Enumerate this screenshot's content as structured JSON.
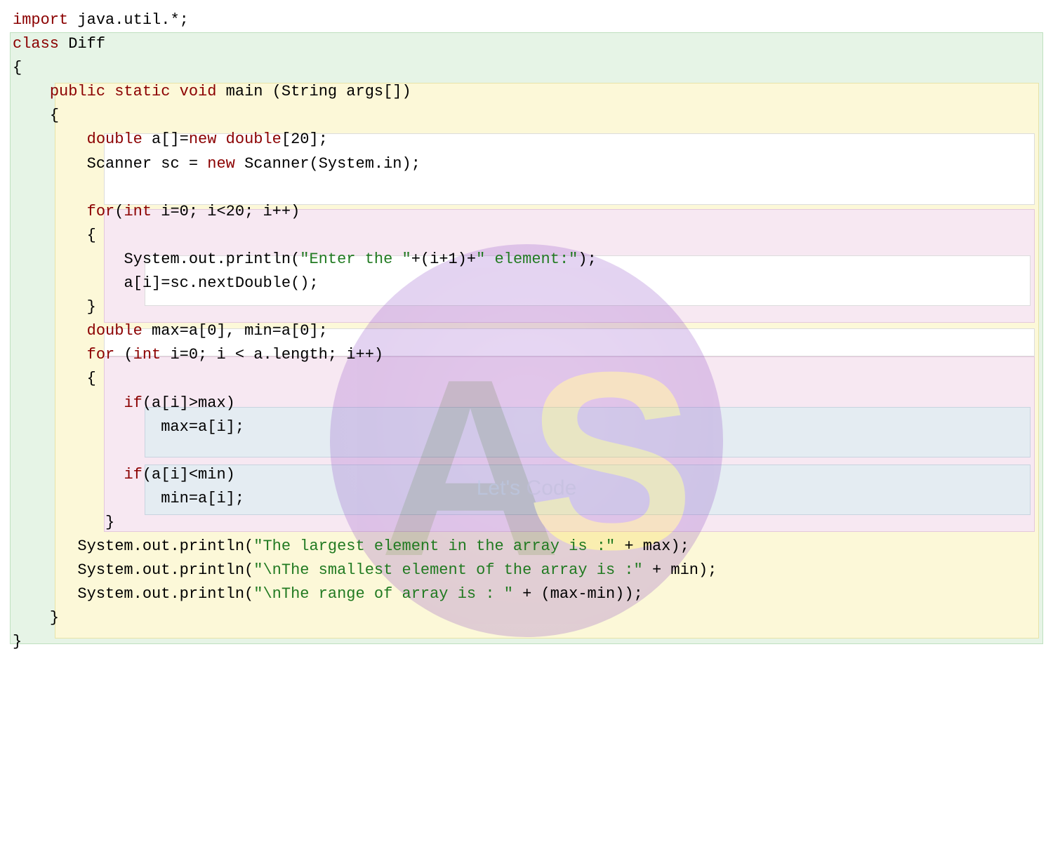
{
  "watermark": {
    "letter1": "A",
    "letter2": "S",
    "tag_part1": "Let's ",
    "tag_part2": "Code"
  },
  "code": {
    "l1_import": "import",
    "l1_pkg": " java.util.*;",
    "l2_class": "class",
    "l2_name": " Diff",
    "l3_brace": "{",
    "l4_pub": "public",
    "l4_static": "static",
    "l4_void": "void",
    "l4_main": " main (String args[])",
    "l5_brace": "{",
    "l6_double": "double",
    "l6_a": " a[]=",
    "l6_new": "new",
    "l6_dbl2": " double",
    "l6_rest": "[20];",
    "l7": "Scanner sc = ",
    "l7_new": "new",
    "l7_rest": " Scanner(System.in);",
    "l8_for": "for",
    "l8_open": "(",
    "l8_int": "int",
    "l8_rest": " i=0; i<20; i++)",
    "l9_brace": "{",
    "l10_a": "System.out.println(",
    "l10_s1": "\"Enter the \"",
    "l10_b": "+(i+1)+",
    "l10_s2": "\" element:\"",
    "l10_c": ");",
    "l11": "a[i]=sc.nextDouble();",
    "l12_brace": "}",
    "l13_double": "double",
    "l13_rest": " max=a[0], min=a[0];",
    "l14_for": "for",
    "l14_open": " (",
    "l14_int": "int",
    "l14_rest": " i=0; i < a.length; i++)",
    "l15_brace": "{",
    "l16_if": "if",
    "l16_rest": "(a[i]>max)",
    "l17": "max=a[i];",
    "l18_if": "if",
    "l18_rest": "(a[i]<min)",
    "l19": "min=a[i];",
    "l20_brace": "}",
    "l21_a": "System.out.println(",
    "l21_s": "\"The largest element in the array is :\"",
    "l21_b": " + max);",
    "l22_a": "System.out.println(",
    "l22_s": "\"\\nThe smallest element of the array is :\"",
    "l22_b": " + min);",
    "l23_a": "System.out.println(",
    "l23_s": "\"\\nThe range of array is : \"",
    "l23_b": " + (max-min));",
    "l24_brace": "}",
    "l25_brace": "}"
  }
}
